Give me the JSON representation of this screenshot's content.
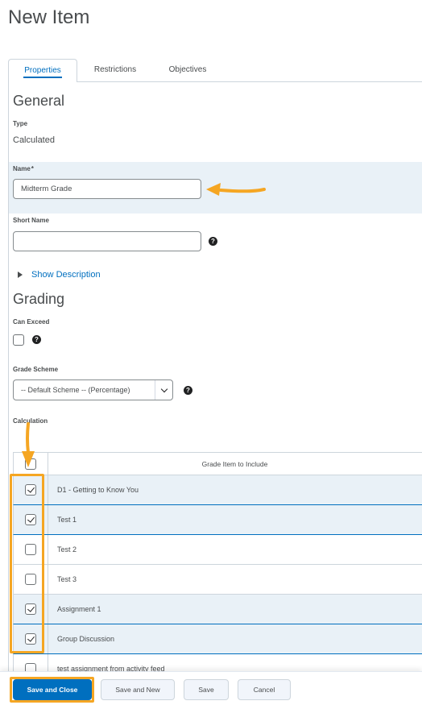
{
  "page": {
    "title": "New Item"
  },
  "tabs": [
    {
      "label": "Properties",
      "active": true
    },
    {
      "label": "Restrictions",
      "active": false
    },
    {
      "label": "Objectives",
      "active": false
    }
  ],
  "general": {
    "heading": "General",
    "type_label": "Type",
    "type_value": "Calculated",
    "name_label": "Name",
    "name_required_mark": "*",
    "name_value": "Midterm Grade",
    "short_name_label": "Short Name",
    "short_name_value": "",
    "show_description": "Show Description"
  },
  "grading": {
    "heading": "Grading",
    "can_exceed_label": "Can Exceed",
    "can_exceed_checked": false,
    "grade_scheme_label": "Grade Scheme",
    "grade_scheme_value": "-- Default Scheme -- (Percentage)",
    "calculation_label": "Calculation",
    "column_header": "Grade Item to Include",
    "items": [
      {
        "label": "D1 - Getting to Know You",
        "checked": true
      },
      {
        "label": "Test 1",
        "checked": true
      },
      {
        "label": "Test 2",
        "checked": false
      },
      {
        "label": "Test 3",
        "checked": false
      },
      {
        "label": "Assignment 1",
        "checked": true
      },
      {
        "label": "Group Discussion",
        "checked": true
      },
      {
        "label": "test assignment from activity feed",
        "checked": false
      }
    ]
  },
  "footer": {
    "save_close": "Save and Close",
    "save_new": "Save and New",
    "save": "Save",
    "cancel": "Cancel"
  },
  "colors": {
    "accent": "#006fbf",
    "highlight": "#f5a623",
    "selected_row": "#e9f1f7"
  },
  "icons": [
    "help-icon",
    "expand-triangle-icon",
    "chevron-down-icon",
    "checkmark-icon",
    "annotation-arrow-icon"
  ]
}
